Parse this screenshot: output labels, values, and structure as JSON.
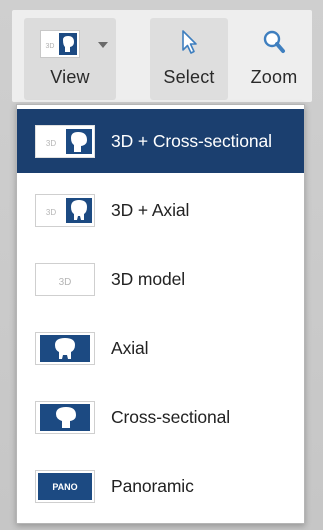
{
  "toolbar": {
    "view_label": "View",
    "select_label": "Select",
    "zoom_label": "Zoom"
  },
  "menu": {
    "items": [
      {
        "label": "3D + Cross-sectional",
        "icon": "3d-cross-sectional-icon",
        "selected": true
      },
      {
        "label": "3D + Axial",
        "icon": "3d-axial-icon",
        "selected": false
      },
      {
        "label": "3D model",
        "icon": "3d-model-icon",
        "selected": false
      },
      {
        "label": "Axial",
        "icon": "axial-icon",
        "selected": false
      },
      {
        "label": "Cross-sectional",
        "icon": "cross-sectional-icon",
        "selected": false
      },
      {
        "label": "Panoramic",
        "icon": "panoramic-icon",
        "selected": false
      }
    ]
  },
  "icon_text": {
    "three_d": "3D",
    "pano": "PANO"
  },
  "colors": {
    "accent": "#1b3f6f",
    "icon_blue": "#1c4a82",
    "toolbar_bg": "#eeeeee",
    "menu_bg": "#ffffff",
    "text": "#222222"
  }
}
